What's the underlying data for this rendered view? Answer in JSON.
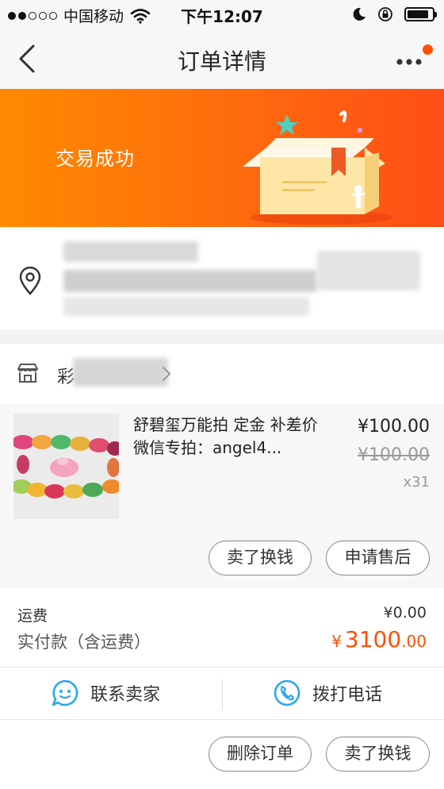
{
  "status_bar": {
    "carrier": "中国移动",
    "time": "下午12:07",
    "battery_level": 0.85
  },
  "navbar": {
    "title": "订单详情"
  },
  "banner": {
    "status_text": "交易成功"
  },
  "shop": {
    "name": "彩"
  },
  "product": {
    "title": "舒碧玺万能拍 定金 补差价 微信专拍：angel4...",
    "price": "¥100.00",
    "original_price": "¥100.00",
    "quantity": "x31",
    "buttons": {
      "sell": "卖了换钱",
      "after_sales": "申请售后"
    }
  },
  "totals": {
    "shipping_label": "运费",
    "shipping_value": "¥0.00",
    "paid_label": "实付款（含运费）",
    "paid_currency": "¥",
    "paid_integer": "3100",
    "paid_decimal": ".00"
  },
  "contact": {
    "seller": "联系卖家",
    "call": "拨打电话"
  },
  "footer": {
    "delete": "删除订单",
    "sell": "卖了换钱"
  },
  "colors": {
    "accent": "#ff5000",
    "banner_start": "#ff8a00",
    "banner_end": "#ff4e16",
    "icon_blue": "#29a8f0"
  },
  "icons": {
    "back": "chevron-left-icon",
    "more": "more-dots-icon",
    "location": "location-pin-icon",
    "shop": "shop-icon",
    "chat": "chat-bubble-icon",
    "phone": "phone-icon"
  }
}
